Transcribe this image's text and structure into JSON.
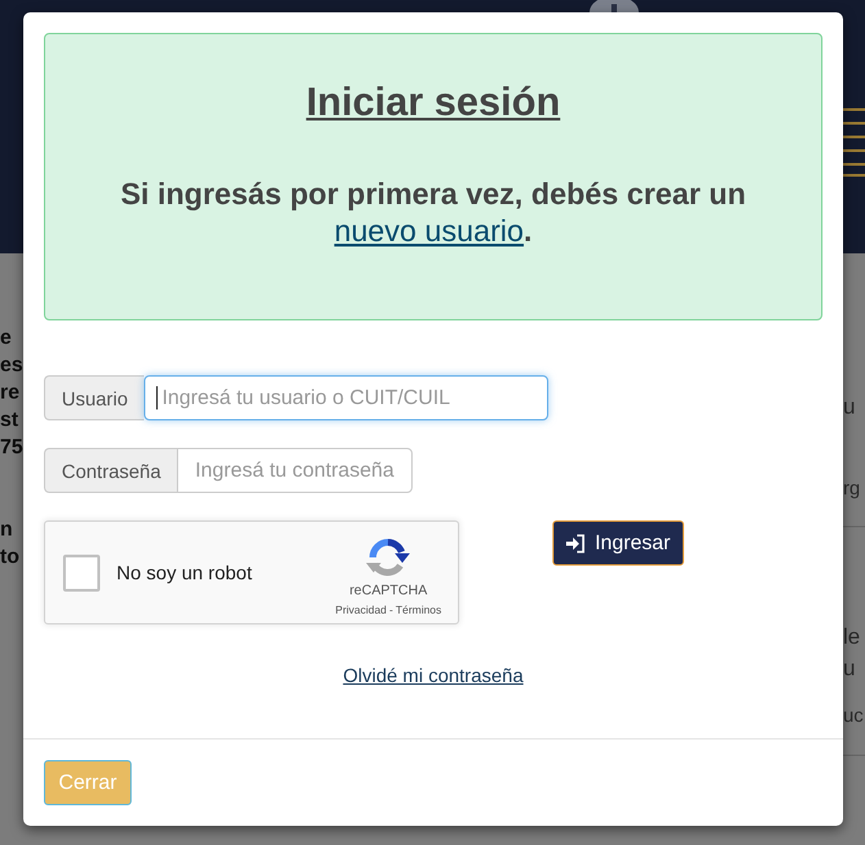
{
  "page": {
    "left_fragments": [
      {
        "lines": [
          "e",
          "es",
          "re",
          "st",
          "75"
        ]
      },
      {
        "lines": [
          "n",
          "to"
        ]
      }
    ],
    "right_cards": [
      {
        "title_lines": [
          "u"
        ],
        "meta": "rg"
      },
      {
        "title_lines": [
          "le",
          "u"
        ],
        "meta": "uc"
      }
    ]
  },
  "login_modal": {
    "notice": {
      "title": "Iniciar sesión",
      "text": "Si ingresás por primera vez, debés crear un",
      "link": "nuevo usuario",
      "text_end": "."
    },
    "fields": [
      {
        "kind": "text",
        "label": "Usuario",
        "placeholder": "Ingresá tu usuario o CUIT/CUIL",
        "focused": true
      },
      {
        "kind": "password",
        "label": "Contraseña",
        "placeholder": "Ingresá tu contraseña",
        "focused": false
      }
    ],
    "captcha": {
      "label": "No soy un robot",
      "checked": false,
      "brand": "reCAPTCHA",
      "links": [
        "Privacidad",
        "Términos"
      ],
      "separator": "-"
    },
    "submit_button": "Ingresar",
    "forgot_link": "Olvidé mi contraseña",
    "close_button": "Cerrar"
  }
}
